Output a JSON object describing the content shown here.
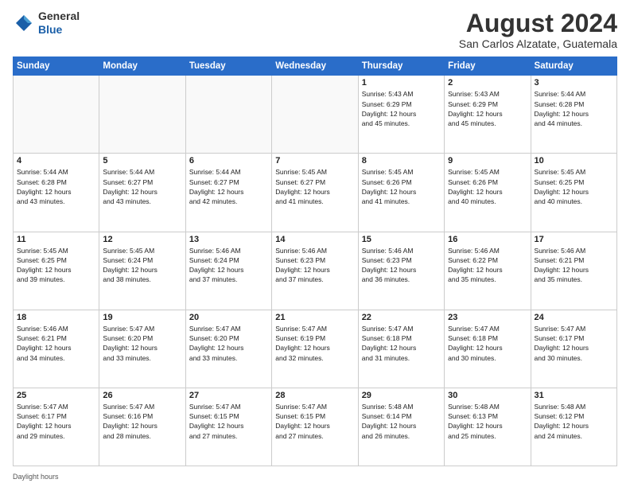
{
  "header": {
    "logo_line1": "General",
    "logo_line2": "Blue",
    "title": "August 2024",
    "location": "San Carlos Alzatate, Guatemala"
  },
  "days_of_week": [
    "Sunday",
    "Monday",
    "Tuesday",
    "Wednesday",
    "Thursday",
    "Friday",
    "Saturday"
  ],
  "note_label": "Daylight hours",
  "weeks": [
    [
      {
        "day": "",
        "info": ""
      },
      {
        "day": "",
        "info": ""
      },
      {
        "day": "",
        "info": ""
      },
      {
        "day": "",
        "info": ""
      },
      {
        "day": "1",
        "info": "Sunrise: 5:43 AM\nSunset: 6:29 PM\nDaylight: 12 hours\nand 45 minutes."
      },
      {
        "day": "2",
        "info": "Sunrise: 5:43 AM\nSunset: 6:29 PM\nDaylight: 12 hours\nand 45 minutes."
      },
      {
        "day": "3",
        "info": "Sunrise: 5:44 AM\nSunset: 6:28 PM\nDaylight: 12 hours\nand 44 minutes."
      }
    ],
    [
      {
        "day": "4",
        "info": "Sunrise: 5:44 AM\nSunset: 6:28 PM\nDaylight: 12 hours\nand 43 minutes."
      },
      {
        "day": "5",
        "info": "Sunrise: 5:44 AM\nSunset: 6:27 PM\nDaylight: 12 hours\nand 43 minutes."
      },
      {
        "day": "6",
        "info": "Sunrise: 5:44 AM\nSunset: 6:27 PM\nDaylight: 12 hours\nand 42 minutes."
      },
      {
        "day": "7",
        "info": "Sunrise: 5:45 AM\nSunset: 6:27 PM\nDaylight: 12 hours\nand 41 minutes."
      },
      {
        "day": "8",
        "info": "Sunrise: 5:45 AM\nSunset: 6:26 PM\nDaylight: 12 hours\nand 41 minutes."
      },
      {
        "day": "9",
        "info": "Sunrise: 5:45 AM\nSunset: 6:26 PM\nDaylight: 12 hours\nand 40 minutes."
      },
      {
        "day": "10",
        "info": "Sunrise: 5:45 AM\nSunset: 6:25 PM\nDaylight: 12 hours\nand 40 minutes."
      }
    ],
    [
      {
        "day": "11",
        "info": "Sunrise: 5:45 AM\nSunset: 6:25 PM\nDaylight: 12 hours\nand 39 minutes."
      },
      {
        "day": "12",
        "info": "Sunrise: 5:45 AM\nSunset: 6:24 PM\nDaylight: 12 hours\nand 38 minutes."
      },
      {
        "day": "13",
        "info": "Sunrise: 5:46 AM\nSunset: 6:24 PM\nDaylight: 12 hours\nand 37 minutes."
      },
      {
        "day": "14",
        "info": "Sunrise: 5:46 AM\nSunset: 6:23 PM\nDaylight: 12 hours\nand 37 minutes."
      },
      {
        "day": "15",
        "info": "Sunrise: 5:46 AM\nSunset: 6:23 PM\nDaylight: 12 hours\nand 36 minutes."
      },
      {
        "day": "16",
        "info": "Sunrise: 5:46 AM\nSunset: 6:22 PM\nDaylight: 12 hours\nand 35 minutes."
      },
      {
        "day": "17",
        "info": "Sunrise: 5:46 AM\nSunset: 6:21 PM\nDaylight: 12 hours\nand 35 minutes."
      }
    ],
    [
      {
        "day": "18",
        "info": "Sunrise: 5:46 AM\nSunset: 6:21 PM\nDaylight: 12 hours\nand 34 minutes."
      },
      {
        "day": "19",
        "info": "Sunrise: 5:47 AM\nSunset: 6:20 PM\nDaylight: 12 hours\nand 33 minutes."
      },
      {
        "day": "20",
        "info": "Sunrise: 5:47 AM\nSunset: 6:20 PM\nDaylight: 12 hours\nand 33 minutes."
      },
      {
        "day": "21",
        "info": "Sunrise: 5:47 AM\nSunset: 6:19 PM\nDaylight: 12 hours\nand 32 minutes."
      },
      {
        "day": "22",
        "info": "Sunrise: 5:47 AM\nSunset: 6:18 PM\nDaylight: 12 hours\nand 31 minutes."
      },
      {
        "day": "23",
        "info": "Sunrise: 5:47 AM\nSunset: 6:18 PM\nDaylight: 12 hours\nand 30 minutes."
      },
      {
        "day": "24",
        "info": "Sunrise: 5:47 AM\nSunset: 6:17 PM\nDaylight: 12 hours\nand 30 minutes."
      }
    ],
    [
      {
        "day": "25",
        "info": "Sunrise: 5:47 AM\nSunset: 6:17 PM\nDaylight: 12 hours\nand 29 minutes."
      },
      {
        "day": "26",
        "info": "Sunrise: 5:47 AM\nSunset: 6:16 PM\nDaylight: 12 hours\nand 28 minutes."
      },
      {
        "day": "27",
        "info": "Sunrise: 5:47 AM\nSunset: 6:15 PM\nDaylight: 12 hours\nand 27 minutes."
      },
      {
        "day": "28",
        "info": "Sunrise: 5:47 AM\nSunset: 6:15 PM\nDaylight: 12 hours\nand 27 minutes."
      },
      {
        "day": "29",
        "info": "Sunrise: 5:48 AM\nSunset: 6:14 PM\nDaylight: 12 hours\nand 26 minutes."
      },
      {
        "day": "30",
        "info": "Sunrise: 5:48 AM\nSunset: 6:13 PM\nDaylight: 12 hours\nand 25 minutes."
      },
      {
        "day": "31",
        "info": "Sunrise: 5:48 AM\nSunset: 6:12 PM\nDaylight: 12 hours\nand 24 minutes."
      }
    ]
  ]
}
